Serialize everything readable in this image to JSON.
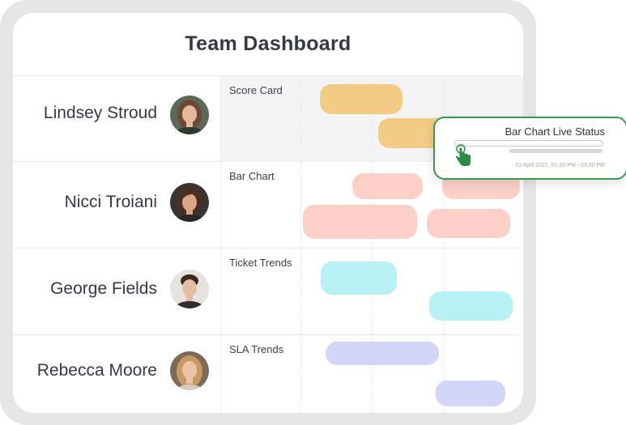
{
  "dashboard": {
    "title": "Team Dashboard"
  },
  "rows": [
    {
      "person": "Lindsey Stroud",
      "task": "Score Card",
      "color": "#f2cc85",
      "avatar": {
        "hair": "#6b4a35",
        "skin": "#e6b89a",
        "bg": "#5a6a5a"
      }
    },
    {
      "person": "Nicci Troiani",
      "task": "Bar Chart",
      "color": "#fbd0c8",
      "avatar": {
        "hair": "#4a2e22",
        "skin": "#d9a584",
        "bg": "#3b3431"
      }
    },
    {
      "person": "George Fields",
      "task": "Ticket Trends",
      "color": "#b8f1f3",
      "avatar": {
        "hair": "#3b2a22",
        "skin": "#e4bfa6",
        "bg": "#e6e2df"
      }
    },
    {
      "person": "Rebecca Moore",
      "task": "SLA Trends",
      "color": "#d2d5f6",
      "avatar": {
        "hair": "#c79a63",
        "skin": "#ecc4a8",
        "bg": "#7f6a5a"
      }
    }
  ],
  "popup": {
    "title": "Bar Chart Live Status",
    "time": "23 April 2022, 01:20 PM - 03:50 PM",
    "border_color": "#3a9a4f",
    "icon": "hand-pointer-icon"
  }
}
